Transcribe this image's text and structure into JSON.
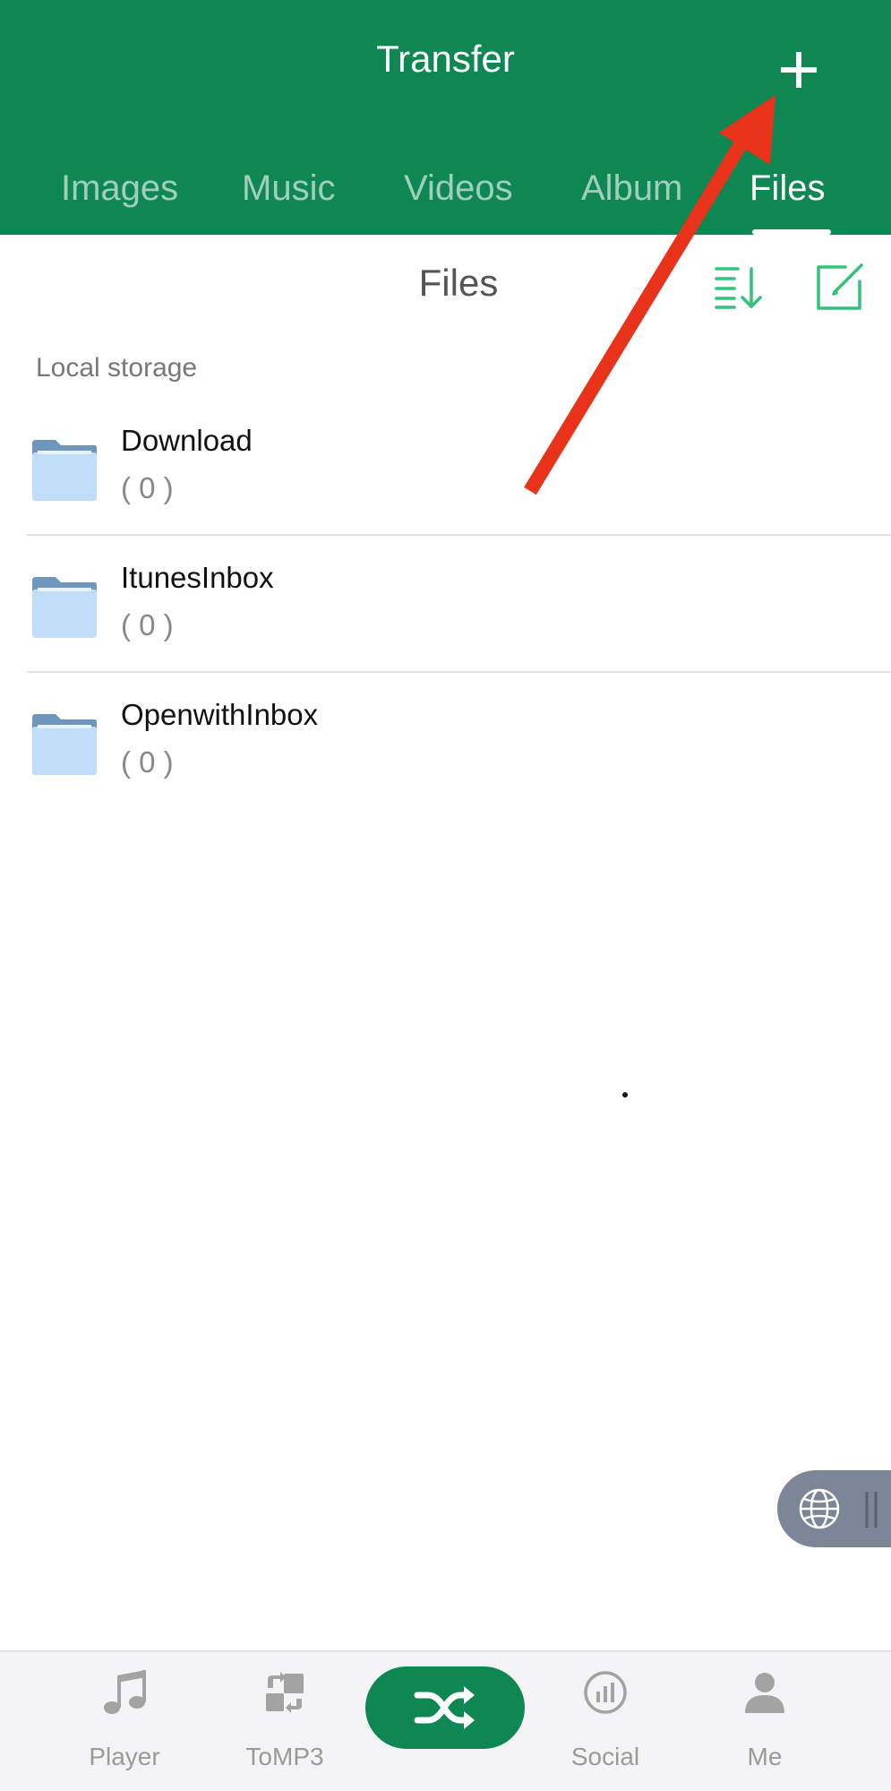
{
  "header": {
    "title": "Transfer",
    "add_icon": "plus-icon"
  },
  "tabs": [
    {
      "label": "Images"
    },
    {
      "label": "Music"
    },
    {
      "label": "Videos"
    },
    {
      "label": "Album"
    },
    {
      "label": "Files",
      "active": true
    }
  ],
  "subheader": {
    "title": "Files",
    "sort_icon": "sort-icon",
    "edit_icon": "edit-icon"
  },
  "section": {
    "label": "Local storage"
  },
  "folders": [
    {
      "name": "Download",
      "count": "( 0 )"
    },
    {
      "name": "ItunesInbox",
      "count": "( 0 )"
    },
    {
      "name": "OpenwithInbox",
      "count": "( 0 )"
    }
  ],
  "floating_button": {
    "icon": "globe-icon"
  },
  "bottom_nav": [
    {
      "label": "Player",
      "icon": "music-note-icon"
    },
    {
      "label": "ToMP3",
      "icon": "convert-icon"
    },
    {
      "label": "",
      "icon": "shuffle-icon"
    },
    {
      "label": "Social",
      "icon": "chart-icon"
    },
    {
      "label": "Me",
      "icon": "person-icon"
    }
  ],
  "colors": {
    "primary": "#0e8752",
    "accent_green": "#33c27a",
    "annotation_arrow": "#e8321a"
  }
}
